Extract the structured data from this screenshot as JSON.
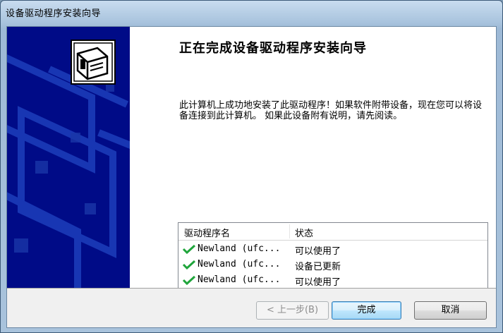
{
  "window": {
    "title": "设备驱动程序安装向导"
  },
  "wizard": {
    "heading": "正在完成设备驱动程序安装向导",
    "description": "此计算机上成功地安装了此驱动程序！如果软件附带设备，现在您可以将设备连接到此计算机。 如果此设备附有说明，请先阅读。"
  },
  "driver_list": {
    "columns": [
      "驱动程序名",
      "状态"
    ],
    "rows": [
      {
        "name": "Newland (ufc...",
        "status": "可以使用了"
      },
      {
        "name": "Newland (ufc...",
        "status": "设备已更新"
      },
      {
        "name": "Newland (ufc...",
        "status": "可以使用了"
      }
    ]
  },
  "buttons": {
    "back": "< 上一步(B)",
    "finish": "完成",
    "cancel": "取消"
  },
  "icons": {
    "banner": "hardware-device-icon",
    "row_status": "green-checkmark-icon"
  },
  "colors": {
    "banner_bg": "#000b87",
    "checkmark": "#1fa53b",
    "default_button_border": "#3c7fb1"
  }
}
